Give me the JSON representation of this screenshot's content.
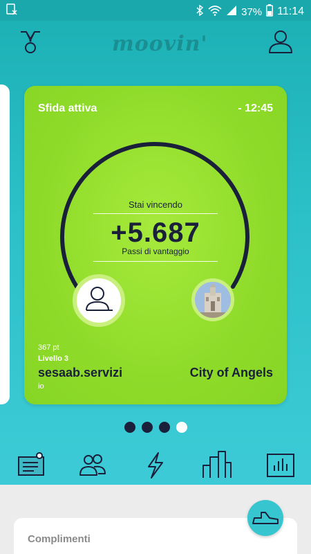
{
  "status_bar": {
    "battery": "37%",
    "time": "11:14"
  },
  "header": {
    "logo_text": "moovin'"
  },
  "challenge": {
    "title": "Sfida attiva",
    "time_remaining": "- 12:45",
    "status": "Stai vincendo",
    "advantage": "+5.687",
    "advantage_label": "Passi di vantaggio",
    "me": {
      "points": "367 pt",
      "level": "Livello 3",
      "name": "sesaab.servizi",
      "tag": "io"
    },
    "opponent": {
      "name": "City of Angels"
    }
  },
  "pager": {
    "pages": 4,
    "active_index": 3
  },
  "nav": [
    "news-icon",
    "friends-icon",
    "activity-icon",
    "city-icon",
    "stats-icon"
  ],
  "sheet": {
    "title": "Complimenti"
  },
  "colors": {
    "teal": "#1bb0b4",
    "card_green": "#8fdb2a",
    "dark": "#1a1f3a"
  }
}
